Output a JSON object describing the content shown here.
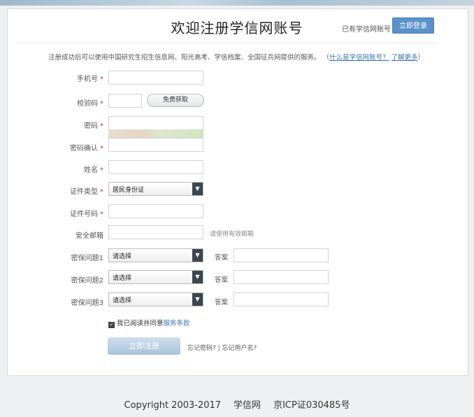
{
  "header": {
    "title": "欢迎注册学信网账号",
    "have_account": "已有学信网账号",
    "login_button": "立即登录"
  },
  "notice": {
    "text": "注册成功后可以使用中国研究生招生信息网、阳光高考、学信档案、全国征兵网提供的服务。",
    "link_what": "什么是学信网账号？",
    "link_more": "了解更多",
    "paren_open": "（",
    "paren_close": "）"
  },
  "form": {
    "phone_label": "手机号",
    "code_label": "校验码",
    "code_button": "免费获取",
    "password_label": "密码",
    "password_confirm_label": "密码确认",
    "name_label": "姓名",
    "id_type_label": "证件类型",
    "id_type_value": "居民身份证",
    "id_number_label": "证件号码",
    "email_label": "安全邮箱",
    "email_hint": "请使用有效邮箱",
    "q1_label": "密保问题1",
    "q2_label": "密保问题2",
    "q3_label": "密保问题3",
    "q_placeholder": "请选择",
    "answer_label": "答案",
    "required_mark": "*",
    "agree_text": "我已阅读并同意",
    "terms_link": "服务条款",
    "register_button": "立即注册",
    "forgot_text": "忘记密码? | 忘记用户名?"
  },
  "footer": {
    "copyright": "Copyright 2003-2017",
    "site": "学信网",
    "icp": "京ICP证030485号"
  },
  "colors": {
    "primary": "#5b92c9",
    "link": "#3b74b5",
    "select_arrow": "#3d4650"
  }
}
